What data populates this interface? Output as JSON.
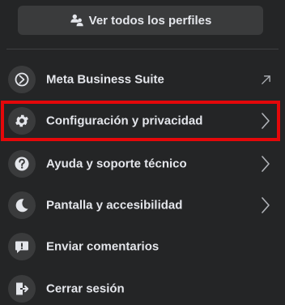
{
  "profiles_button": {
    "label": "Ver todos los perfiles",
    "icon": "switch-profiles-icon"
  },
  "menu": [
    {
      "label": "Meta Business Suite",
      "icon": "meta-business-suite-icon",
      "trailing": "external-link-arrow-icon"
    },
    {
      "label": "Configuración y privacidad",
      "icon": "gear-icon",
      "trailing": "chevron-right-icon"
    },
    {
      "label": "Ayuda y soporte técnico",
      "icon": "question-icon",
      "trailing": "chevron-right-icon"
    },
    {
      "label": "Pantalla y accesibilidad",
      "icon": "moon-icon",
      "trailing": "chevron-right-icon"
    },
    {
      "label": "Enviar comentarios",
      "icon": "feedback-icon",
      "trailing": ""
    },
    {
      "label": "Cerrar sesión",
      "icon": "logout-icon",
      "trailing": ""
    }
  ],
  "highlighted_item": "Configuración y privacidad",
  "colors": {
    "background": "#242526",
    "button": "#3a3b3c",
    "text": "#e4e6eb",
    "highlight": "#e4080a"
  }
}
